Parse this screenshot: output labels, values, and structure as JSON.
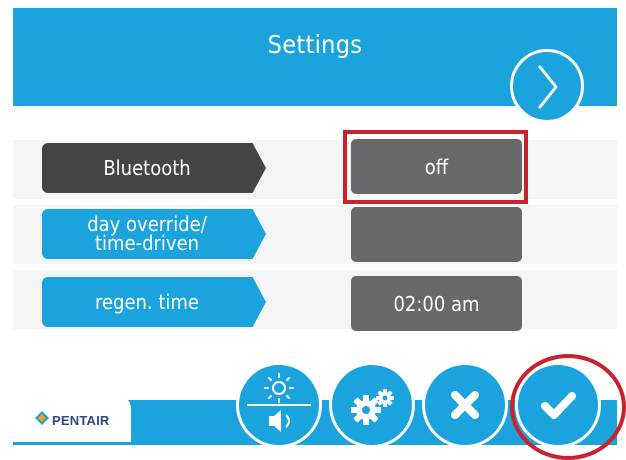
{
  "header": {
    "title": "Settings"
  },
  "nav": {
    "next_icon": "chevron-right-icon"
  },
  "rows": [
    {
      "label": "Bluetooth",
      "value": "off",
      "style": "dark"
    },
    {
      "label_line1": "day override/",
      "label_line2": "time-driven",
      "value": "",
      "style": "blue"
    },
    {
      "label": "regen. time",
      "value": "02:00 am",
      "style": "blue"
    }
  ],
  "highlights": {
    "bluetooth_value": "red-rectangle",
    "confirm_button": "red-circle"
  },
  "footer": {
    "brand": "PENTAIR",
    "buttons": [
      "brightness-volume-icon",
      "gears-icon",
      "close-icon",
      "check-icon"
    ]
  },
  "colors": {
    "accent": "#1aa3dc",
    "dark_label": "#444446",
    "value_box": "#67686a",
    "highlight": "#c8232c"
  }
}
